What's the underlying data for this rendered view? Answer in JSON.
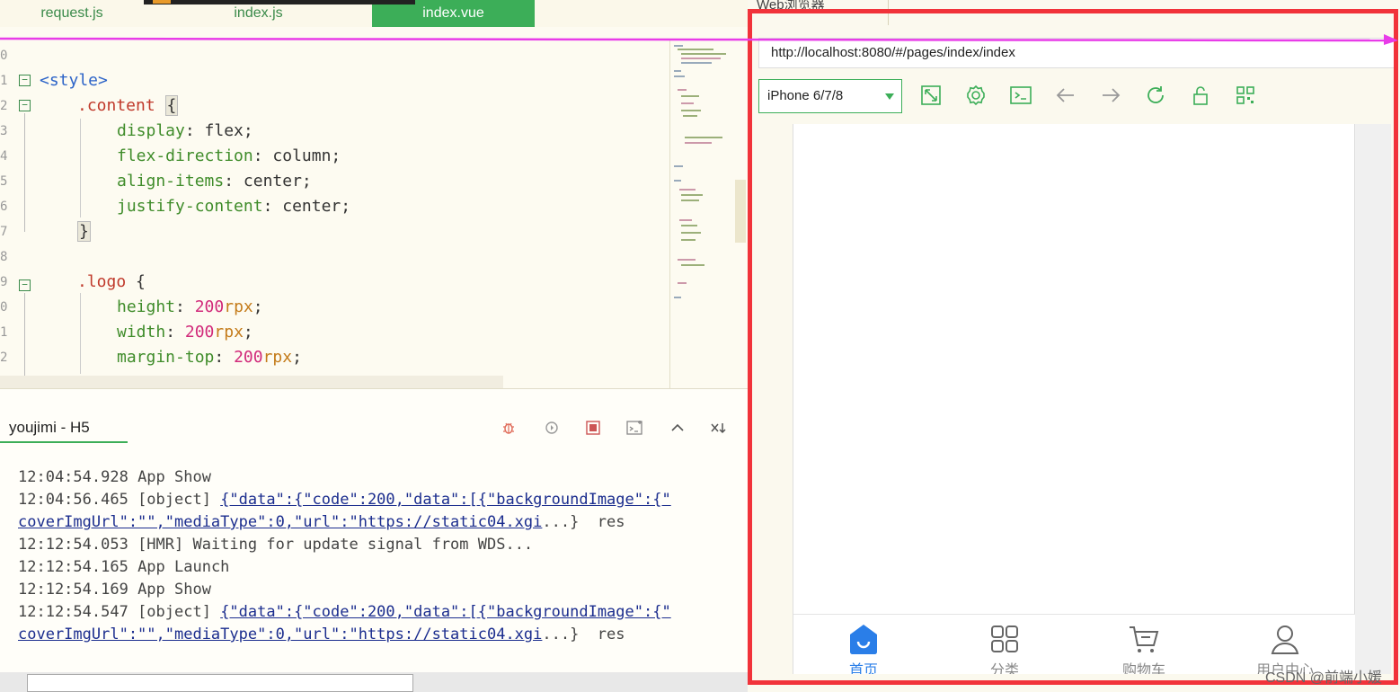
{
  "editor": {
    "tabs": [
      "request.js",
      "index.js",
      "index.vue"
    ],
    "active_tab": "index.vue",
    "line_numbers": [
      "0",
      "1",
      "2",
      "3",
      "4",
      "5",
      "6",
      "7",
      "8",
      "9",
      "0",
      "1",
      "2"
    ],
    "code": {
      "l1_tag": "<style>",
      "l2_selector": ".content",
      "l2_brace": "{",
      "l3_prop": "display",
      "l3_value": ": flex;",
      "l4_prop": "flex-direction",
      "l4_value": ": column;",
      "l5_prop": "align-items",
      "l5_value": ": center;",
      "l6_prop": "justify-content",
      "l6_value": ": center;",
      "l7_brace": "}",
      "l9_selector": ".logo",
      "l9_brace": " {",
      "l10_prop": "height",
      "l10_num": "200",
      "l10_unit": "rpx",
      "l11_prop": "width",
      "l11_num": "200",
      "l11_unit": "rpx",
      "l12_prop": "margin-top",
      "l12_num": "200",
      "l12_unit": "rpx",
      "colon_space": ": ",
      "semicolon": ";"
    }
  },
  "console": {
    "tab_label": "youjimi - H5",
    "logs": [
      {
        "time": "12:04:54.928",
        "text": " App Show"
      },
      {
        "time": "12:04:56.465",
        "text": " [object] ",
        "link": "{\"data\":{\"code\":200,\"data\":[{\"backgroundImage\":{\"",
        "link2": "coverImgUrl\":\"\",\"mediaType\":0,\"url\":\"https://static04.xgi",
        "tail": "...}  res"
      },
      {
        "time": "12:12:54.053",
        "text": " [HMR] Waiting for update signal from WDS..."
      },
      {
        "time": "12:12:54.165",
        "text": " App Launch"
      },
      {
        "time": "12:12:54.169",
        "text": " App Show"
      },
      {
        "time": "12:12:54.547",
        "text": " [object] ",
        "link": "{\"data\":{\"code\":200,\"data\":[{\"backgroundImage\":{\"",
        "link2": "coverImgUrl\":\"\",\"mediaType\":0,\"url\":\"https://static04.xgi",
        "tail": "...}  res"
      }
    ],
    "tool_icons": [
      "bug-icon",
      "replay-icon",
      "stop-icon",
      "terminal-add-icon",
      "chevron-up-icon",
      "clear-down-icon"
    ]
  },
  "browser": {
    "tab_title": "Web浏览器",
    "tab_close": "×",
    "url": "http://localhost:8080/#/pages/index/index",
    "device": "iPhone 6/7/8",
    "tool_icons": [
      "resize-icon",
      "settings-icon",
      "console-icon",
      "back-icon",
      "forward-icon",
      "refresh-icon",
      "unlock-icon",
      "qrcode-icon"
    ],
    "tabbar": [
      {
        "label": "首页",
        "icon": "home-icon"
      },
      {
        "label": "分类",
        "icon": "grid-icon"
      },
      {
        "label": "购物车",
        "icon": "cart-icon"
      },
      {
        "label": "用户中心",
        "icon": "user-icon"
      }
    ]
  },
  "colors": {
    "accent_green": "#3cae58",
    "frame_red": "#f1333a",
    "arrow_magenta": "#e83ce8",
    "home_blue": "#2a7ee8"
  },
  "watermark": "CSDN @前端小媛"
}
